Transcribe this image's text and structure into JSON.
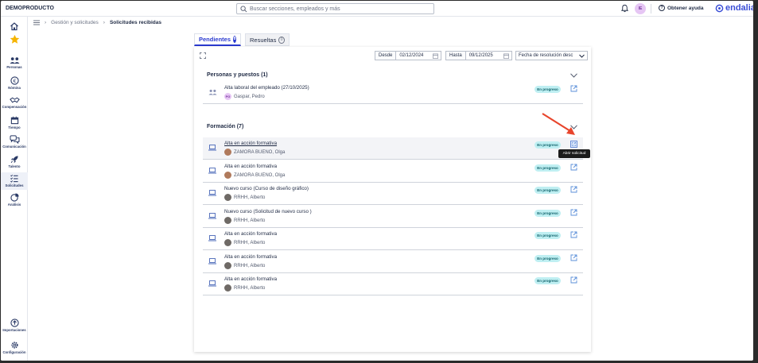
{
  "app": {
    "brand": "DEMOPRODUCTO",
    "search_placeholder": "Buscar secciones, empleados y más",
    "user_initials": "IE",
    "help_label": "Obtener ayuda",
    "logo_text": "endalia",
    "accent": "#2a3ad0"
  },
  "sidebar": {
    "items": [
      {
        "label": "",
        "icon": "home-icon"
      },
      {
        "label": "",
        "icon": "star-icon"
      },
      {
        "label": "Personas",
        "icon": "people-icon"
      },
      {
        "label": "Nómina",
        "icon": "payroll-icon"
      },
      {
        "label": "Compensación",
        "icon": "handshake-icon"
      },
      {
        "label": "Tiempo",
        "icon": "calendar-icon"
      },
      {
        "label": "Comunicación",
        "icon": "chat-icon"
      },
      {
        "label": "Talento",
        "icon": "rocket-icon"
      },
      {
        "label": "Solicitudes",
        "icon": "list-icon"
      },
      {
        "label": "Análisis",
        "icon": "pie-icon"
      },
      {
        "label": "Importaciones",
        "icon": "upload-icon"
      },
      {
        "label": "Configuración",
        "icon": "gear-icon"
      }
    ]
  },
  "breadcrumb": {
    "parent": "Gestión y solicitudes",
    "current": "Solicitudes recibidas"
  },
  "tabs": {
    "pending_label": "Pendientes",
    "pending_count": "8",
    "resolved_label": "Resueltas",
    "resolved_count": "0"
  },
  "filters": {
    "from_label": "Desde",
    "from_value": "02/12/2024",
    "to_label": "Hasta",
    "to_value": "09/12/2025",
    "sort_value": "Fecha de resolución desc"
  },
  "sections": {
    "personas": {
      "title": "Personas y puestos (1)",
      "rows": [
        {
          "title": "Alta laboral del empleado (27/10/2025)",
          "person": "Gaspar, Pedro",
          "initials": "PG",
          "status": "En progreso"
        }
      ]
    },
    "formacion": {
      "title": "Formación (7)",
      "rows": [
        {
          "title": "Alta en acción formativa",
          "person": "ZAMORA BUENO, Olga",
          "status": "En progreso"
        },
        {
          "title": "Alta en acción formativa",
          "person": "ZAMORA BUENO, Olga",
          "status": "En progreso"
        },
        {
          "title": "Nuevo curso (Curso de diseño gráfico)",
          "person": "RRHH, Alberto",
          "status": "En progreso"
        },
        {
          "title": "Nuevo curso (Solicitud de nuevo curso )",
          "person": "RRHH, Alberto",
          "status": "En progreso"
        },
        {
          "title": "Alta en acción formativa",
          "person": "RRHH, Alberto",
          "status": "En progreso"
        },
        {
          "title": "Alta en acción formativa",
          "person": "RRHH, Alberto",
          "status": "En progreso"
        },
        {
          "title": "Alta en acción formativa",
          "person": "RRHH, Alberto",
          "status": "En progreso"
        }
      ]
    }
  },
  "tooltip": "Abrir solicitud"
}
